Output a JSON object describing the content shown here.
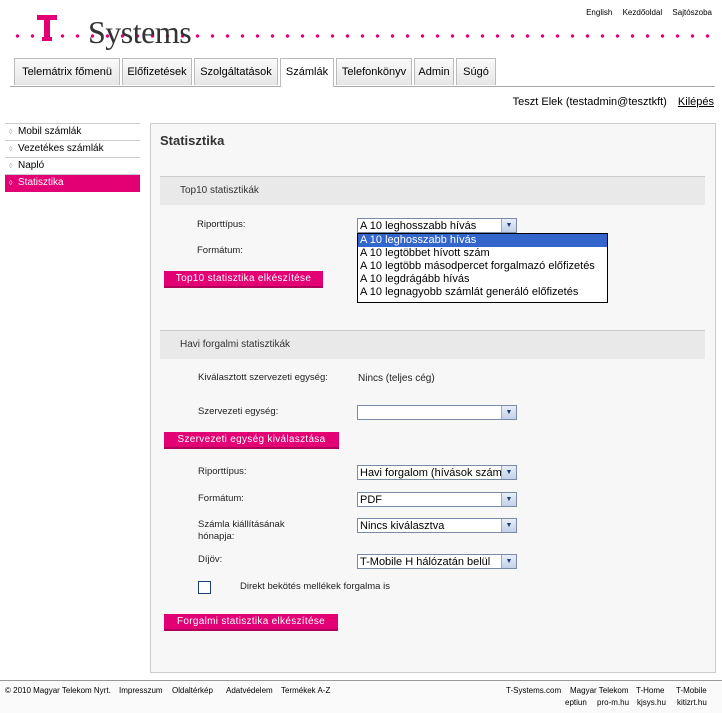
{
  "top_links": [
    "English",
    "Kezdőoldal",
    "Sajtószoba"
  ],
  "brand": {
    "name": "Systems",
    "logo_letter": "T",
    "accent": "#e20074"
  },
  "nav": {
    "tabs": [
      "Telemátrix főmenü",
      "Előfizetések",
      "Szolgáltatások",
      "Számlák",
      "Telefonkönyv",
      "Admin",
      "Súgó"
    ],
    "active": "Számlák"
  },
  "user": {
    "name": "Teszt Elek (testadmin@tesztkft)",
    "logout": "Kilépés"
  },
  "sidebar": {
    "items": [
      "Mobil számlák",
      "Vezetékes számlák",
      "Napló",
      "Statisztika"
    ],
    "active": "Statisztika"
  },
  "page_title": "Statisztika",
  "top10": {
    "header": "Top10 statisztikák",
    "report_type_label": "Riporttípus:",
    "report_type_value": "A 10 leghosszabb hívás",
    "format_label": "Formátum:",
    "button": "Top10 statisztika elkészítése",
    "dropdown_options": [
      "A 10 leghosszabb hívás",
      "A 10 legtöbbet hívott szám",
      "A 10 legtöbb másodpercet forgalmazó előfizetés",
      "A 10 legdrágább hívás",
      "A 10 legnagyobb számlát generáló előfizetés"
    ]
  },
  "monthly": {
    "header": "Havi forgalmi statisztikák",
    "selected_unit_label": "Kiválasztott szervezeti egység:",
    "selected_unit_value": "Nincs (teljes cég)",
    "unit_label": "Szervezeti egység:",
    "unit_value": "",
    "select_unit_button": "Szervezeti egység kiválasztása",
    "report_type_label": "Riporttípus:",
    "report_type_value": "Havi forgalom (hívások szám",
    "format_label": "Formátum:",
    "format_value": "PDF",
    "issue_month_label": "Számla kiállításának hónapja:",
    "issue_month_value": "Nincs kiválasztva",
    "tariff_label": "Díjöv:",
    "tariff_value": "T-Mobile H hálózatán belül",
    "checkbox_label": "Direkt bekötés mellékek forgalma is",
    "button": "Forgalmi statisztika elkészítése"
  },
  "footer": {
    "copyright": "© 2010 Magyar Telekom Nyrt.",
    "links": [
      "Impresszum",
      "Oldaltérkép",
      "Adatvédelem",
      "Termékek A-Z"
    ],
    "partners_row1": [
      "T-Systems.com",
      "Magyar Telekom",
      "T-Home",
      "T-Mobile"
    ],
    "partners_row2": [
      "eptiun",
      "pro-m.hu",
      "kjsys.hu",
      "kitizrt.hu"
    ]
  }
}
